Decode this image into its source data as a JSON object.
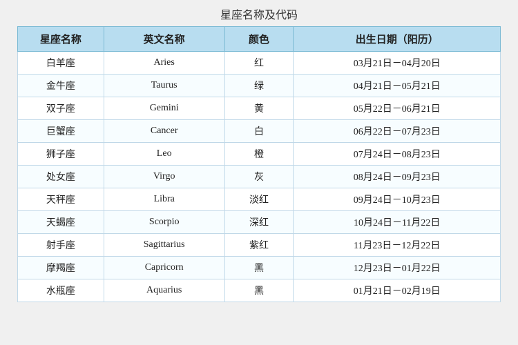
{
  "page": {
    "title": "星座名称及代码"
  },
  "table": {
    "headers": [
      {
        "key": "chinese",
        "label": "星座名称"
      },
      {
        "key": "english",
        "label": "英文名称"
      },
      {
        "key": "color",
        "label": "颜色"
      },
      {
        "key": "date",
        "label": "出生日期（阳历）"
      }
    ],
    "rows": [
      {
        "chinese": "白羊座",
        "english": "Aries",
        "color": "红",
        "date": "03月21日－04月20日"
      },
      {
        "chinese": "金牛座",
        "english": "Taurus",
        "color": "绿",
        "date": "04月21日－05月21日"
      },
      {
        "chinese": "双子座",
        "english": "Gemini",
        "color": "黄",
        "date": "05月22日－06月21日"
      },
      {
        "chinese": "巨蟹座",
        "english": "Cancer",
        "color": "白",
        "date": "06月22日－07月23日"
      },
      {
        "chinese": "狮子座",
        "english": "Leo",
        "color": "橙",
        "date": "07月24日－08月23日"
      },
      {
        "chinese": "处女座",
        "english": "Virgo",
        "color": "灰",
        "date": "08月24日－09月23日"
      },
      {
        "chinese": "天秤座",
        "english": "Libra",
        "color": "淡红",
        "date": "09月24日－10月23日"
      },
      {
        "chinese": "天蝎座",
        "english": "Scorpio",
        "color": "深红",
        "date": "10月24日－11月22日"
      },
      {
        "chinese": "射手座",
        "english": "Sagittarius",
        "color": "紫红",
        "date": "11月23日－12月22日"
      },
      {
        "chinese": "摩羯座",
        "english": "Capricorn",
        "color": "黑",
        "date": "12月23日－01月22日"
      },
      {
        "chinese": "水瓶座",
        "english": "Aquarius",
        "color": "黑",
        "date": "01月21日－02月19日"
      }
    ]
  }
}
